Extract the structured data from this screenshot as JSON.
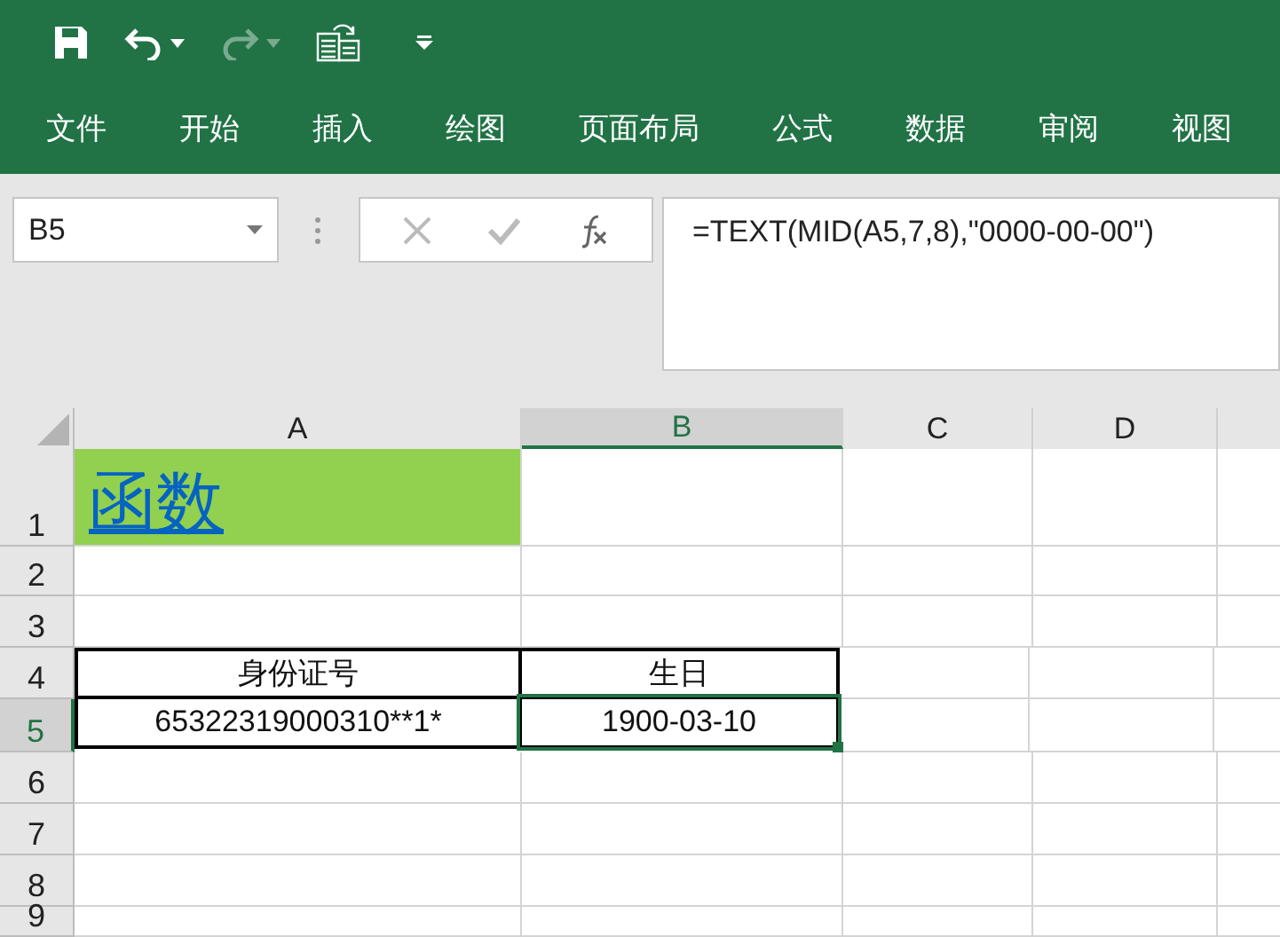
{
  "ribbon_tabs": [
    {
      "label": "文件",
      "selected": false
    },
    {
      "label": "开始",
      "selected": false
    },
    {
      "label": "插入",
      "selected": false
    },
    {
      "label": "绘图",
      "selected": false
    },
    {
      "label": "页面布局",
      "selected": false
    },
    {
      "label": "公式",
      "selected": false
    },
    {
      "label": "数据",
      "selected": false
    },
    {
      "label": "审阅",
      "selected": false
    },
    {
      "label": "视图",
      "selected": false
    }
  ],
  "name_box": {
    "value": "B5"
  },
  "formula_bar": {
    "value": "=TEXT(MID(A5,7,8),\"0000-00-00\")"
  },
  "columns": [
    {
      "label": "A",
      "selected": false
    },
    {
      "label": "B",
      "selected": true
    },
    {
      "label": "C",
      "selected": false
    },
    {
      "label": "D",
      "selected": false
    }
  ],
  "rows": [
    {
      "label": "1",
      "selected": false,
      "cells": [
        {
          "kind": "title",
          "text": "函数",
          "selected": false
        }
      ]
    },
    {
      "label": "2",
      "selected": false,
      "cells": []
    },
    {
      "label": "3",
      "selected": false,
      "cells": []
    },
    {
      "label": "4",
      "selected": false,
      "cells": [
        {
          "kind": "header",
          "text": "身份证号",
          "selected": false
        },
        {
          "kind": "header",
          "text": "生日",
          "selected": false
        }
      ]
    },
    {
      "label": "5",
      "selected": true,
      "cells": [
        {
          "kind": "data",
          "text": "65322319000310**1*",
          "selected": false
        },
        {
          "kind": "data",
          "text": "1900-03-10",
          "selected": true
        }
      ]
    },
    {
      "label": "6",
      "selected": false,
      "cells": []
    },
    {
      "label": "7",
      "selected": false,
      "cells": []
    },
    {
      "label": "8",
      "selected": false,
      "cells": []
    },
    {
      "label": "9",
      "selected": false,
      "cells": []
    }
  ]
}
